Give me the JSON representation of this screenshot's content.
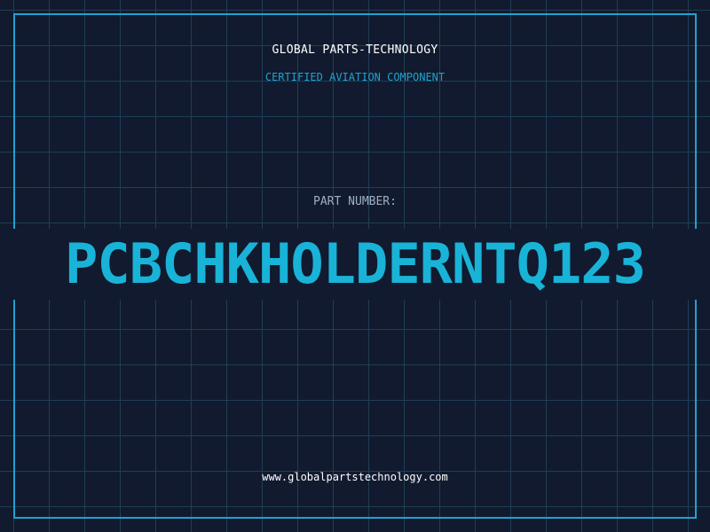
{
  "header": {
    "brand": "GLOBAL PARTS-TECHNOLOGY",
    "subtitle": "CERTIFIED AVIATION COMPONENT"
  },
  "part": {
    "label": "PART NUMBER:",
    "number": "PCBCHKHOLDERNTQ123"
  },
  "footer": {
    "url": "www.globalpartstechnology.com"
  },
  "colors": {
    "background": "#111a2e",
    "grid": "#1e3f57",
    "accent": "#1fa3cf",
    "part_number": "#19b3d8"
  }
}
